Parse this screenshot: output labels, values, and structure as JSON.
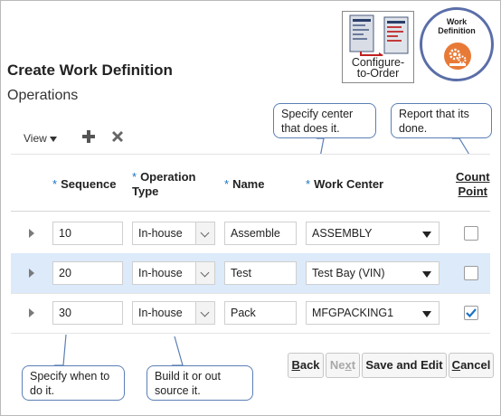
{
  "page": {
    "title": "Create Work Definition",
    "subtitle": "Operations"
  },
  "badges": {
    "configure_to_order": {
      "line1": "Configure-",
      "line2": "to-Order"
    },
    "work_definition": {
      "line1": "Work",
      "line2": "Definition"
    }
  },
  "toolbar": {
    "view_label": "View",
    "add_icon": "plus-icon",
    "delete_icon": "close-icon"
  },
  "table": {
    "columns": [
      {
        "label": "Sequence",
        "required": true
      },
      {
        "label1": "Operation",
        "label2": "Type",
        "required": true
      },
      {
        "label": "Name",
        "required": true
      },
      {
        "label": "Work Center",
        "required": true
      },
      {
        "label1": "Count",
        "label2": "Point",
        "required": false
      }
    ],
    "required_marker": "*",
    "rows": [
      {
        "sequence": "10",
        "operation_type": "In-house",
        "name": "Assemble",
        "work_center": "ASSEMBLY",
        "count_point": false,
        "selected": false
      },
      {
        "sequence": "20",
        "operation_type": "In-house",
        "name": "Test",
        "work_center": "Test Bay (VIN)",
        "count_point": false,
        "selected": true
      },
      {
        "sequence": "30",
        "operation_type": "In-house",
        "name": "Pack",
        "work_center": "MFGPACKING1",
        "count_point": true,
        "selected": false
      }
    ]
  },
  "callouts": {
    "work_center": {
      "line1": "Specify center",
      "line2": "that does it."
    },
    "count_point": {
      "line1": "Report that its",
      "line2": "done."
    },
    "sequence": {
      "line1": "Specify when to",
      "line2": "do it."
    },
    "operation_type": {
      "line1": "Build it or out",
      "line2": "source it."
    }
  },
  "buttons": {
    "back": {
      "first": "B",
      "rest": "ack"
    },
    "next": {
      "first": "Ne",
      "u": "x",
      "rest": "t"
    },
    "save_and_edit": "Save and Edit",
    "cancel": {
      "first": "C",
      "rest": "ancel"
    }
  },
  "colors": {
    "selected_row": "#dceafa",
    "required_marker": "#1a73c6",
    "callout_border": "#5b7fb5",
    "badge_orange": "#e87a37",
    "badge_ring": "#5a6ea8"
  }
}
